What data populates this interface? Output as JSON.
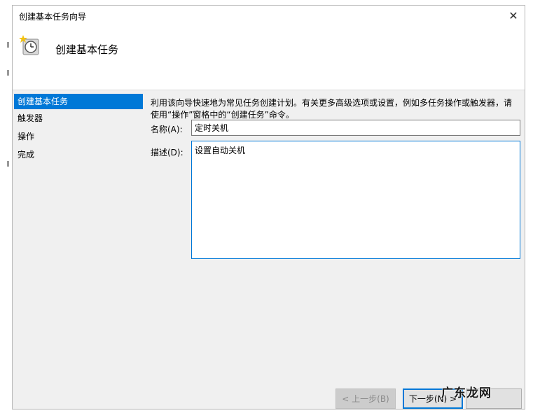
{
  "window": {
    "title": "创建基本任务向导",
    "close_label": "✕"
  },
  "header": {
    "title": "创建基本任务",
    "icon": "task-scheduler-clock-icon"
  },
  "sidebar": {
    "items": [
      {
        "label": "创建基本任务",
        "selected": true
      },
      {
        "label": "触发器",
        "selected": false
      },
      {
        "label": "操作",
        "selected": false
      },
      {
        "label": "完成",
        "selected": false
      }
    ]
  },
  "main": {
    "description": "利用该向导快速地为常见任务创建计划。有关更多高级选项或设置，例如多任务操作或触发器，请使用“操作”窗格中的“创建任务”命令。",
    "name_label": "名称(A):",
    "name_value": "定时关机",
    "desc_label": "描述(D):",
    "desc_value": "设置自动关机"
  },
  "buttons": {
    "back": "< 上一步(B)",
    "next": "下一步(N) >",
    "cancel": ""
  },
  "watermark": "广东龙网",
  "colors": {
    "selection": "#0078d7",
    "content_bg": "#f0f0f0"
  }
}
